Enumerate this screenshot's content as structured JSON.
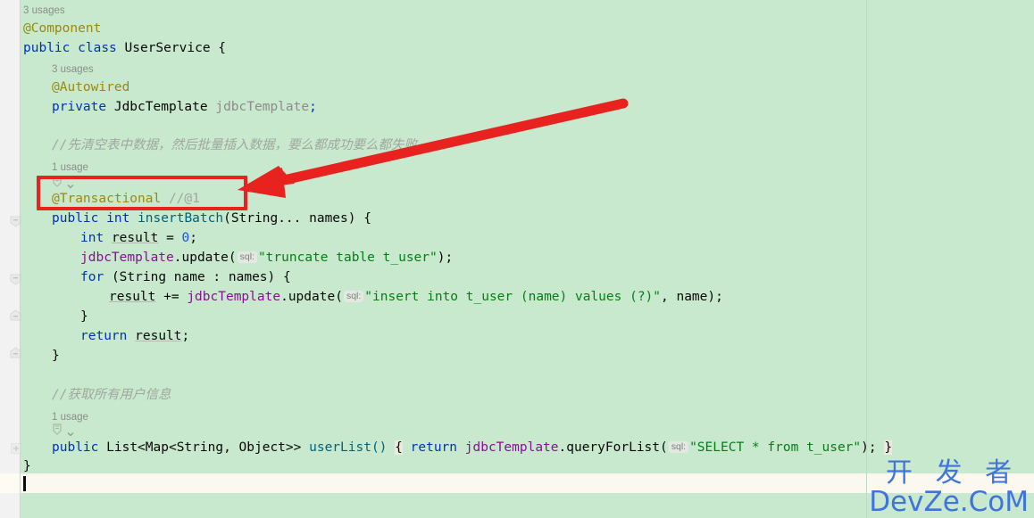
{
  "editor": {
    "background_color": "#c8e9cd",
    "gutter_color": "#f2f2f2",
    "caret_line_color": "#fbf8ef",
    "accent_annotation_color": "#e8221e"
  },
  "lines": {
    "usage_3_class": "3 usages",
    "anno_component": "@Component",
    "class_decl_kw1": "public",
    "class_decl_kw2": "class",
    "class_decl_name": "UserService",
    "class_decl_brace": "{",
    "usage_3_field": "3 usages",
    "anno_autowired": "@Autowired",
    "field_kw": "private",
    "field_type": "JdbcTemplate",
    "field_name": "jdbcTemplate",
    "field_semi": ";",
    "comment_batch": "//先清空表中数据，然后批量插入数据，要么都成功要么都失败",
    "usage_1_insert": "1 usage",
    "anno_transactional": "@Transactional",
    "anno_transactional_trailing": "//@1",
    "method_insert_kw": "public",
    "method_insert_ret": "int",
    "method_insert_name": "insertBatch",
    "method_insert_params": "(String... names) {",
    "stmt_int": "int",
    "stmt_result": "result",
    "stmt_eq": "= ",
    "stmt_zero": "0",
    "stmt_semi": ";",
    "truncate_obj": "jdbcTemplate",
    "truncate_call": ".update(",
    "truncate_hint": "sql:",
    "truncate_sql": "\"truncate table t_user\"",
    "truncate_tail": ");",
    "for_kw": "for",
    "for_head": "(String name : names) {",
    "insert_result": "result",
    "insert_plus": "+= ",
    "insert_obj": "jdbcTemplate",
    "insert_call": ".update(",
    "insert_hint": "sql:",
    "insert_sql": "\"insert into t_user (name) values (?)\"",
    "insert_tail": ", name);",
    "close_for": "}",
    "return_kw": "return",
    "return_val": "result",
    "return_semi": ";",
    "close_method": "}",
    "comment_userlist": "//获取所有用户信息",
    "usage_1_userlist": "1 usage",
    "userlist_kw": "public",
    "userlist_type": "List<Map<String, Object>>",
    "userlist_name": "userList()",
    "userlist_open_brace": "{",
    "userlist_return": "return",
    "userlist_obj": "jdbcTemplate",
    "userlist_call": ".queryForList(",
    "userlist_hint": "sql:",
    "userlist_sql": "\"SELECT * from t_user\"",
    "userlist_tail": ");",
    "userlist_close_brace": "}",
    "close_class": "}"
  },
  "gutter": {
    "fold_collapse_1": "fold-collapse-icon",
    "fold_collapse_2": "fold-collapse-icon",
    "fold_expand_1": "fold-expand-icon",
    "fold_expand_2": "fold-expand-icon",
    "fold_plus": "fold-plus-icon"
  },
  "inlay_icons": {
    "spring_bean_transactional": "spring-bean-icon",
    "spring_bean_userlist": "spring-bean-icon",
    "chevron_transactional": "chevron-down-icon",
    "chevron_userlist": "chevron-down-icon"
  },
  "annotation": {
    "highlight_target": "@Transactional //@1",
    "arrow": "red-arrow-pointer",
    "box": "red-highlight-box"
  },
  "watermark": {
    "chinese": "开 发 者",
    "latin": "DevZe.CoM",
    "color": "#3f74dd"
  }
}
